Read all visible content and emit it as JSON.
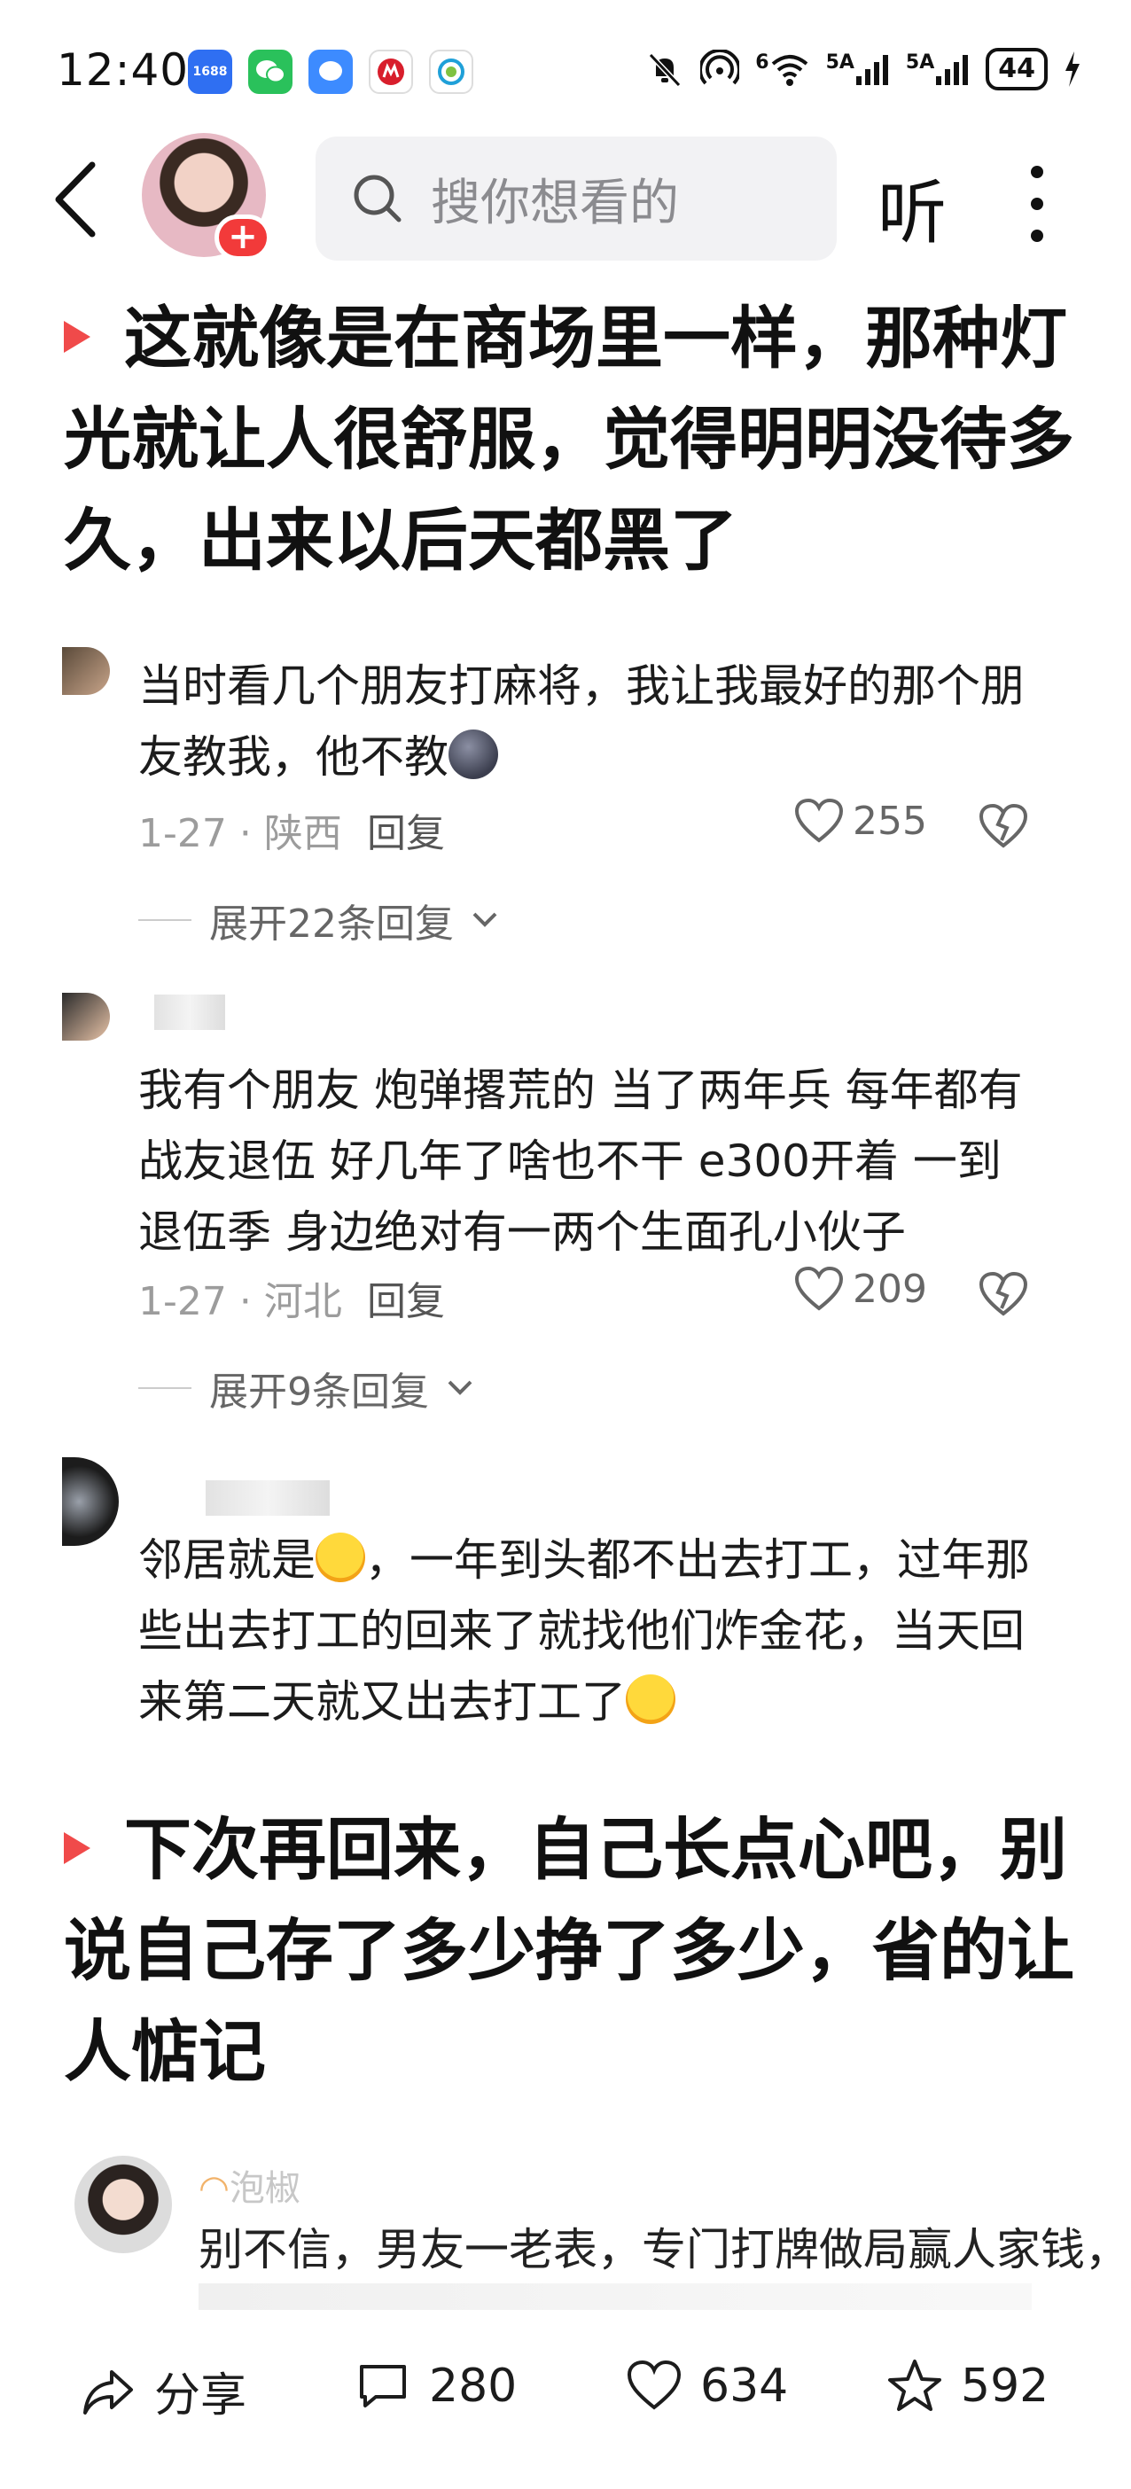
{
  "status_bar": {
    "time": "12:40",
    "app_icons": [
      "1688",
      "wechat",
      "messages",
      "china-merchants-bank",
      "china-mobile"
    ],
    "battery": "44",
    "signal_labels": [
      "5A",
      "5A"
    ],
    "wifi_label": "6"
  },
  "nav": {
    "search_placeholder": "搜你想看的",
    "listen_label": "听",
    "follow_plus": "+"
  },
  "headlines": [
    "这就像是在商场里一样，那种灯光就让人很舒服，觉得明明没待多久，出来以后天都黑了",
    "下次再回来，自己长点心吧，别说自己存了多少挣了多少，省的让人惦记"
  ],
  "comments": [
    {
      "text": "当时看几个朋友打麻将，我让我最好的那个朋友教我，他不教",
      "meta": "1-27 · 陕西",
      "reply": "回复",
      "likes": "255",
      "expand": "展开22条回复"
    },
    {
      "text": "我有个朋友 炮弹撂荒的 当了两年兵 每年都有战友退伍 好几年了啥也不干 e300开着 一到退伍季 身边绝对有一两个生面孔小伙子",
      "meta": "1-27 · 河北",
      "reply": "回复",
      "likes": "209",
      "expand": "展开9条回复"
    },
    {
      "text_a": "邻居就是",
      "text_b": "，一年到头都不出去打工，过年那些出去打工的回来了就找他们炸金花，当天回来第二天就又出去打工了"
    }
  ],
  "preview_comment": {
    "name": "泡椒",
    "text": "别不信，男友一老表，专门打牌做局赢人家钱，"
  },
  "bottom_bar": {
    "share_label": "分享",
    "comments_count": "280",
    "likes_count": "634",
    "favorites_count": "592"
  },
  "colors": {
    "accent_red": "#f04a4a",
    "follow_red": "#f23a3a",
    "search_bg": "#f2f2f4"
  }
}
